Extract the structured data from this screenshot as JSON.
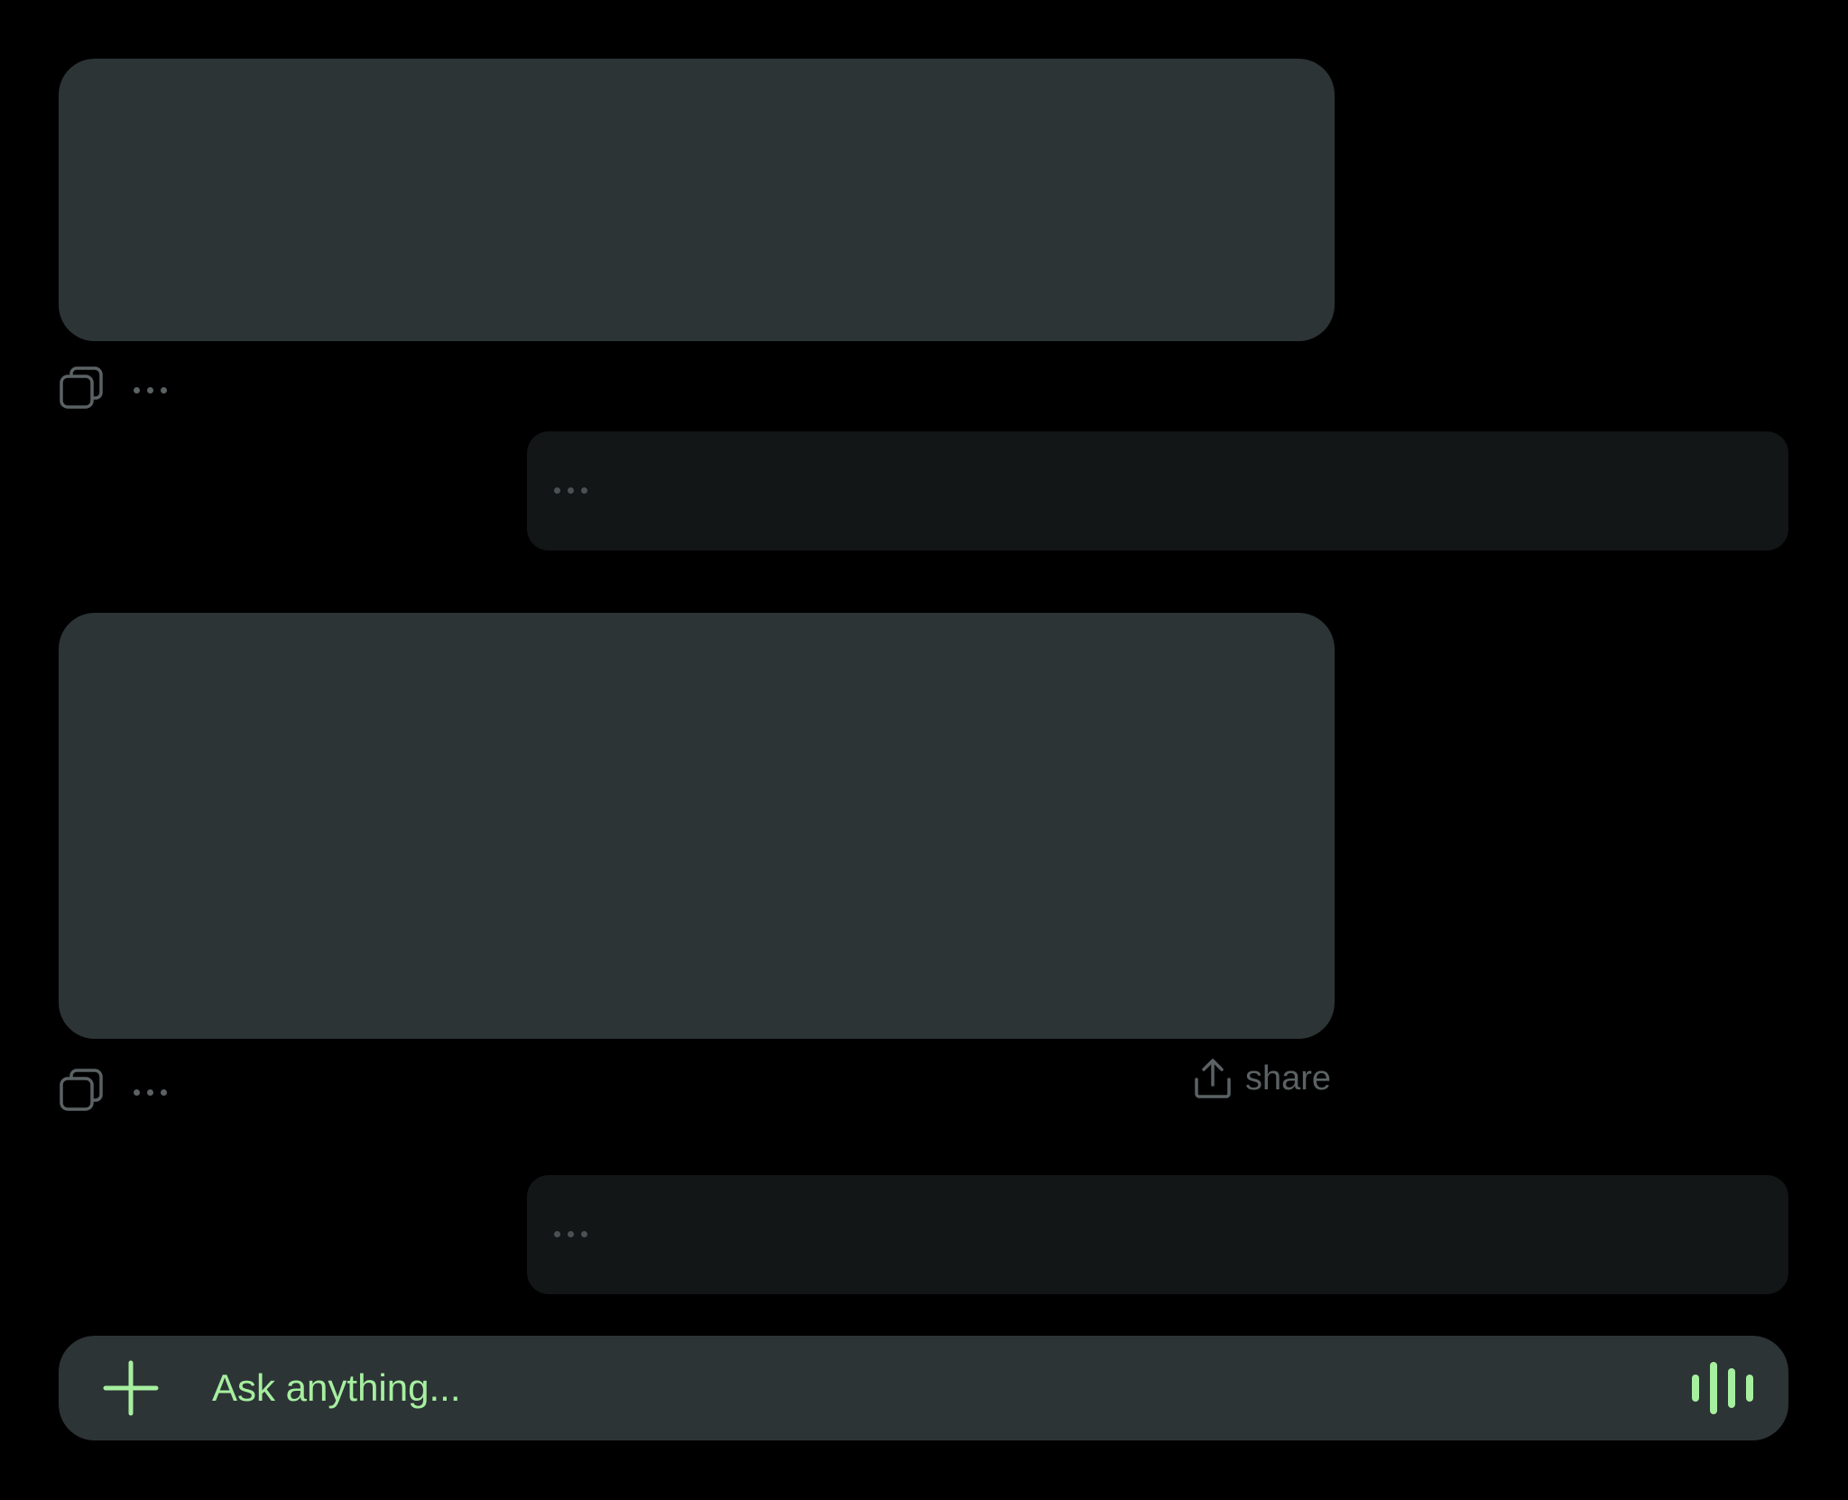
{
  "messages": [
    {
      "role": "user",
      "content": "",
      "actions": [
        "copy-icon",
        "more-icon"
      ]
    },
    {
      "role": "assistant",
      "status": "typing"
    },
    {
      "role": "user",
      "content": "",
      "actions": [
        "copy-icon",
        "more-icon"
      ],
      "share_label": "share"
    },
    {
      "role": "assistant",
      "status": "typing"
    }
  ],
  "composer": {
    "placeholder": "Ask anything...",
    "attach_icon": "plus-icon",
    "voice_icon": "voice-waveform-icon"
  },
  "colors": {
    "background": "#000000",
    "user_bubble": "#2c3436",
    "assistant_bubble": "#121617",
    "accent": "#a6ef9f",
    "muted": "#5b6264"
  }
}
